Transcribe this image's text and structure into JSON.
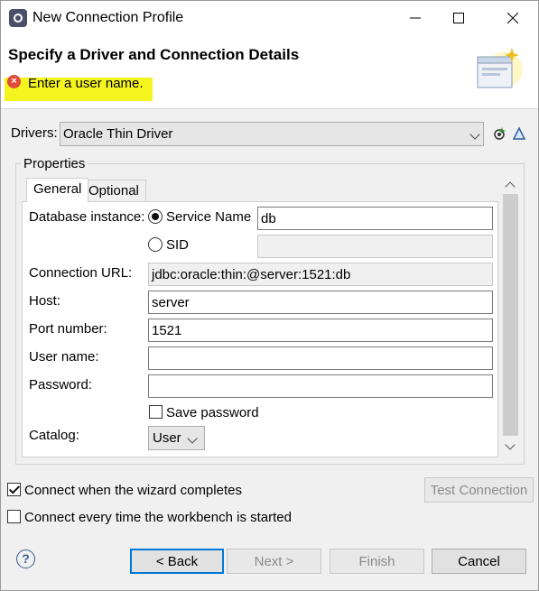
{
  "window": {
    "title": "New Connection Profile"
  },
  "header": {
    "title": "Specify a Driver and Connection Details",
    "error_message": "Enter a user name."
  },
  "drivers": {
    "label": "Drivers:",
    "selected": "Oracle Thin Driver"
  },
  "properties": {
    "group_label": "Properties",
    "tabs": [
      "General",
      "Optional"
    ],
    "database_instance_label": "Database instance:",
    "service_name_label": "Service Name",
    "service_name_value": "db",
    "sid_label": "SID",
    "sid_value": "",
    "connection_url_label": "Connection URL:",
    "connection_url_value": "jdbc:oracle:thin:@server:1521:db",
    "host_label": "Host:",
    "host_value": "server",
    "port_label": "Port number:",
    "port_value": "1521",
    "user_label": "User name:",
    "user_value": "",
    "password_label": "Password:",
    "password_value": "",
    "save_password_label": "Save password",
    "catalog_label": "Catalog:",
    "catalog_value": "User"
  },
  "options": {
    "connect_on_complete": "Connect when the wizard completes",
    "connect_on_startup": "Connect every time the workbench is started",
    "test_connection": "Test Connection"
  },
  "footer": {
    "back": "< Back",
    "next": "Next >",
    "finish": "Finish",
    "cancel": "Cancel"
  },
  "colors": {
    "error": "#e04a3a",
    "highlight": "#f4f41e",
    "focus": "#0078d7"
  }
}
